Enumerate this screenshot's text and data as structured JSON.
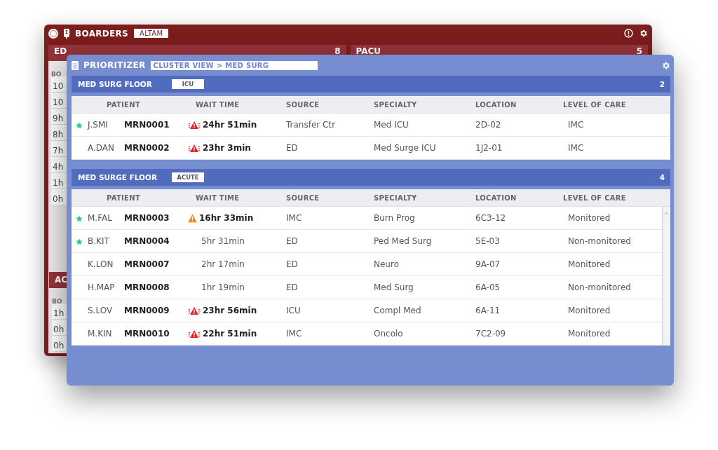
{
  "back_window": {
    "title": "BOARDERS",
    "tag": "ALTAM",
    "panels": [
      {
        "title": "ED",
        "count": "8",
        "column_header": "BO",
        "rows": [
          "10",
          "10",
          "9h",
          "8h",
          "7h",
          "4h",
          "1h",
          "0h"
        ]
      },
      {
        "title": "PACU",
        "count": "5"
      }
    ],
    "lower_panel": {
      "title": "AC",
      "column_header": "BO",
      "rows": [
        "1h",
        "0h",
        "0h"
      ]
    }
  },
  "front_window": {
    "title": "PRIORITIZER",
    "breadcrumb": "CLUSTER VIEW > MED SURG",
    "sections": [
      {
        "title": "MED SURG FLOOR",
        "tag": "ICU",
        "count": "2",
        "scrollbar": false,
        "columns": [
          "PATIENT",
          "WAIT TIME",
          "SOURCE",
          "SPECIALTY",
          "LOCATION",
          "LEVEL OF CARE"
        ],
        "rows": [
          {
            "starred": true,
            "name": "J.SMI",
            "mrn": "MRN0001",
            "kind": "critical",
            "wait": "24hr 51min",
            "source": "Transfer Ctr",
            "specialty": "Med ICU",
            "location": "2D-02",
            "level_of_care": "IMC"
          },
          {
            "starred": false,
            "name": "A.DAN",
            "mrn": "MRN0002",
            "kind": "critical",
            "wait": "23hr 3min",
            "source": "ED",
            "specialty": "Med Surge ICU",
            "location": "1J2-01",
            "level_of_care": "IMC"
          }
        ]
      },
      {
        "title": "MED SURGE FLOOR",
        "tag": "ACUTE",
        "count": "4",
        "scrollbar": true,
        "columns": [
          "PATIENT",
          "WAIT TIME",
          "SOURCE",
          "SPECIALTY",
          "LOCATION",
          "LEVEL OF CARE"
        ],
        "rows": [
          {
            "starred": true,
            "name": "M.FAL",
            "mrn": "MRN0003",
            "kind": "warning",
            "wait": "16hr 33min",
            "source": "IMC",
            "specialty": "Burn Prog",
            "location": "6C3-12",
            "level_of_care": "Monitored"
          },
          {
            "starred": true,
            "name": "B.KIT",
            "mrn": "MRN0004",
            "kind": "plain",
            "wait": "5hr 31min",
            "source": "ED",
            "specialty": "Ped Med Surg",
            "location": "5E-03",
            "level_of_care": "Non-monitored"
          },
          {
            "starred": false,
            "name": "K.LON",
            "mrn": "MRN0007",
            "kind": "plain",
            "wait": "2hr 17min",
            "source": "ED",
            "specialty": "Neuro",
            "location": "9A-07",
            "level_of_care": "Monitored"
          },
          {
            "starred": false,
            "name": "H.MAP",
            "mrn": "MRN0008",
            "kind": "plain",
            "wait": "1hr 19min",
            "source": "ED",
            "specialty": "Med Surg",
            "location": "6A-05",
            "level_of_care": "Non-monitored"
          },
          {
            "starred": false,
            "name": "S.LOV",
            "mrn": "MRN0009",
            "kind": "critical",
            "wait": "23hr 56min",
            "source": "ICU",
            "specialty": "Compl Med",
            "location": "6A-11",
            "level_of_care": "Monitored"
          },
          {
            "starred": false,
            "name": "M.KIN",
            "mrn": "MRN0010",
            "kind": "critical",
            "wait": "22hr 51min",
            "source": "IMC",
            "specialty": "Oncolo",
            "location": "7C2-09",
            "level_of_care": "Monitored"
          }
        ]
      }
    ]
  }
}
